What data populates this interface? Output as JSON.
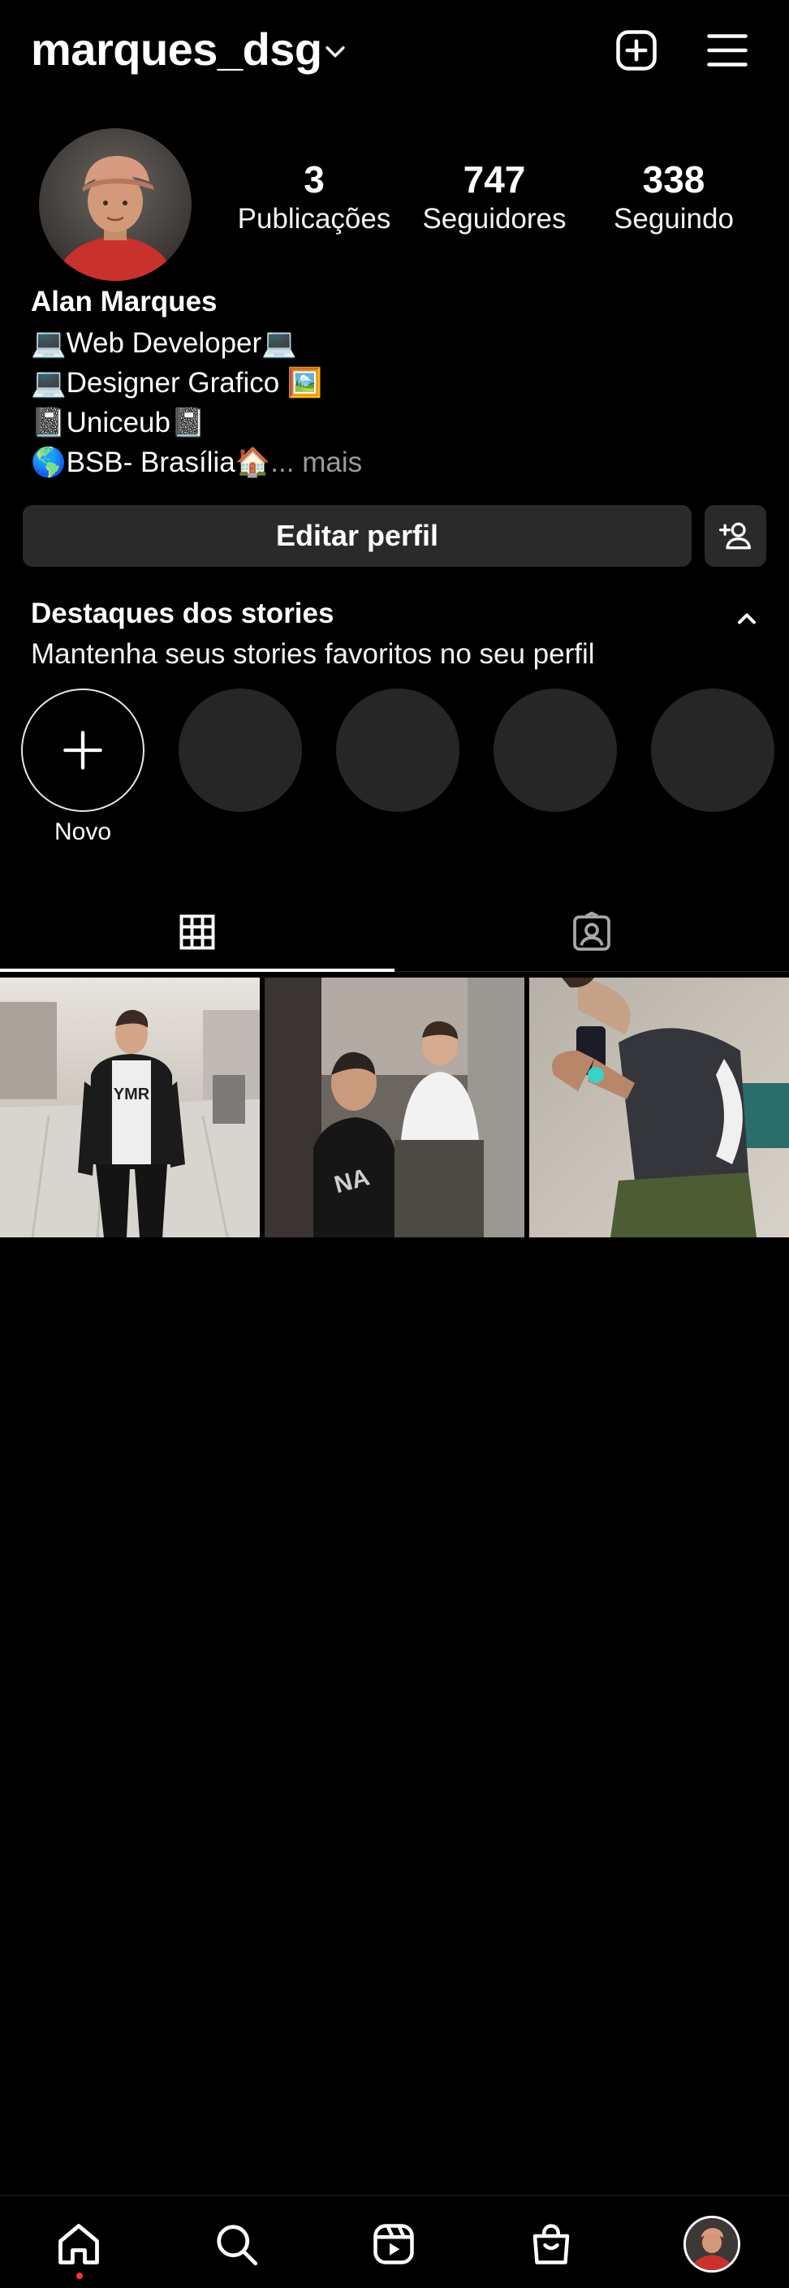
{
  "header": {
    "username": "marques_dsg"
  },
  "stats": [
    {
      "value": "3",
      "label": "Publicações"
    },
    {
      "value": "747",
      "label": "Seguidores"
    },
    {
      "value": "338",
      "label": "Seguindo"
    }
  ],
  "bio": {
    "name": "Alan Marques",
    "lines": [
      "💻Web Developer💻",
      "💻Designer Grafico 🖼️",
      "📓Uniceub📓",
      "🌎BSB- Brasília🏠"
    ],
    "more_ellipsis": "...",
    "more": "mais"
  },
  "actions": {
    "edit_profile": "Editar perfil"
  },
  "highlights": {
    "title": "Destaques dos stories",
    "subtitle": "Mantenha seus stories favoritos no seu perfil",
    "new_label": "Novo"
  },
  "tabs": [
    {
      "icon": "grid-icon",
      "active": true
    },
    {
      "icon": "tagged-icon",
      "active": false
    }
  ],
  "bottom_nav": [
    {
      "icon": "home-icon",
      "active": true
    },
    {
      "icon": "search-icon"
    },
    {
      "icon": "reels-icon"
    },
    {
      "icon": "shop-icon"
    },
    {
      "icon": "profile-avatar"
    }
  ],
  "colors": {
    "background": "#000000",
    "button": "#2a2a2a",
    "notification_dot": "#ff3040",
    "muted_text": "#9a9a9a"
  }
}
